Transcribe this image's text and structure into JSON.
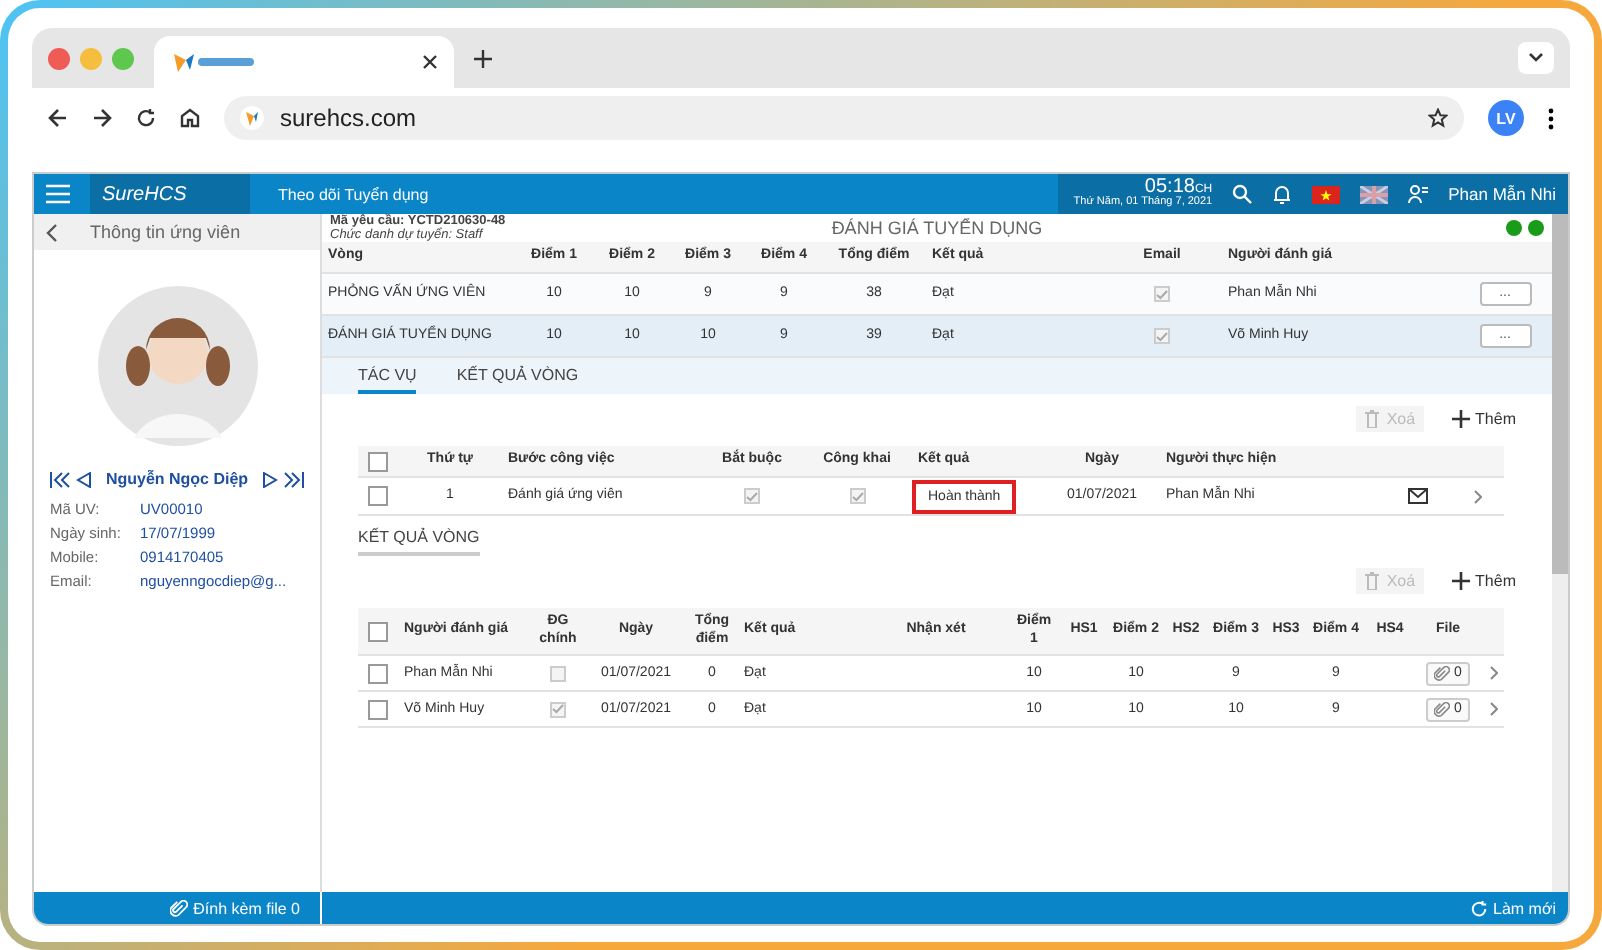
{
  "browser": {
    "url": "surehcs.com",
    "profile": "LV"
  },
  "header": {
    "logo": "SureHCS",
    "module": "Theo dõi Tuyển dụng",
    "time": "05:18",
    "period": "CH",
    "date": "Thứ Năm, 01 Tháng 7, 2021",
    "user": "Phan Mẫn Nhi"
  },
  "sidebar": {
    "title": "Thông tin ứng viên",
    "name": "Nguyễn Ngọc Diệp",
    "fields": [
      {
        "label": "Mã UV:",
        "value": "UV00010"
      },
      {
        "label": "Ngày sinh:",
        "value": "17/07/1999"
      },
      {
        "label": "Mobile:",
        "value": "0914170405"
      },
      {
        "label": "Email:",
        "value": "nguyenngocdiep@g..."
      }
    ],
    "attach": "Đính kèm file 0"
  },
  "request": {
    "code": "Mã yêu cầu: YCTD210630-48",
    "position": "Chức danh dự tuyển: Staff",
    "title": "ĐÁNH GIÁ TUYỂN DỤNG",
    "status_dots": [
      {
        "color": "#1a9c1a"
      },
      {
        "color": "#1a9c1a"
      }
    ]
  },
  "rounds": {
    "columns": [
      "Vòng",
      "Điểm 1",
      "Điểm 2",
      "Điểm 3",
      "Điểm 4",
      "Tổng điểm",
      "Kết quả",
      "Email",
      "Người đánh giá"
    ],
    "rows": [
      {
        "selected": false,
        "round": "PHỎNG VẤN ỨNG VIÊN",
        "scores": [
          "10",
          "10",
          "9",
          "9"
        ],
        "total": "38",
        "result": "Đạt",
        "email": true,
        "assessor": "Phan Mẫn Nhi",
        "more": "..."
      },
      {
        "selected": true,
        "round": "ĐÁNH GIÁ TUYỂN DỤNG",
        "scores": [
          "10",
          "10",
          "10",
          "9"
        ],
        "total": "39",
        "result": "Đạt",
        "email": true,
        "assessor": "Võ Minh Huy",
        "more": "..."
      }
    ]
  },
  "tabs": [
    {
      "label": "TÁC VỤ",
      "selected": true
    },
    {
      "label": "KẾT QUẢ VÒNG",
      "selected": false
    }
  ],
  "tasks": {
    "all_checked": false,
    "delete": {
      "label": "Xoá",
      "disabled": true
    },
    "add": "Thêm",
    "columns": [
      "Thứ tự",
      "Bước công việc",
      "Bắt buộc",
      "Công khai",
      "Kết quả",
      "Ngày",
      "Người thực hiện"
    ],
    "rows": [
      {
        "checked": false,
        "order": "1",
        "step": "Đánh giá ứng viên",
        "required": true,
        "public": true,
        "result": "Hoàn thành",
        "highlighted": true,
        "date": "01/07/2021",
        "performer": "Phan Mẫn Nhi"
      }
    ]
  },
  "results": {
    "all_checked": false,
    "title": "KẾT QUẢ VÒNG",
    "delete": {
      "label": "Xoá",
      "disabled": true
    },
    "add": "Thêm",
    "columns": [
      "Người đánh giá",
      "ĐG chính",
      "Ngày",
      "Tổng điểm",
      "Kết quả",
      "Nhận xét",
      "Điểm 1",
      "HS1",
      "Điểm 2",
      "HS2",
      "Điểm 3",
      "HS3",
      "Điểm 4",
      "HS4",
      "File"
    ],
    "rows": [
      {
        "checked": false,
        "assessor": "Phan Mẫn Nhi",
        "main": false,
        "date": "01/07/2021",
        "total": "0",
        "result": "Đạt",
        "scores": [
          "10",
          "10",
          "9",
          "9"
        ],
        "files": "0"
      },
      {
        "checked": false,
        "assessor": "Võ Minh Huy",
        "main": true,
        "date": "01/07/2021",
        "total": "0",
        "result": "Đạt",
        "scores": [
          "10",
          "10",
          "10",
          "9"
        ],
        "files": "0"
      }
    ]
  },
  "footer": {
    "refresh": "Làm mới"
  }
}
